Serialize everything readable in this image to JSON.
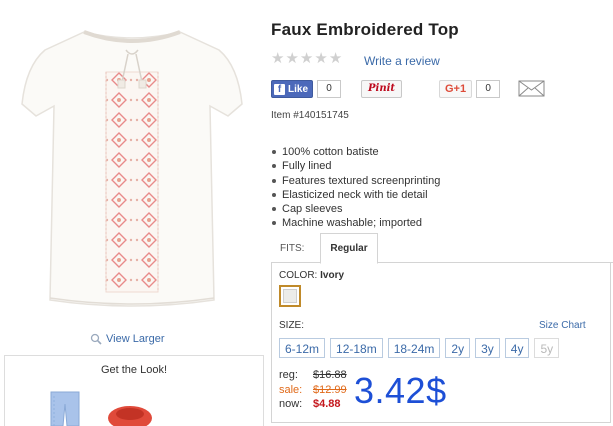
{
  "product": {
    "title": "Faux Embroidered Top",
    "item_number": "Item #140151745",
    "rating_stars": 5,
    "write_review": "Write a review",
    "view_larger": "View Larger",
    "features": [
      "100% cotton batiste",
      "Fully lined",
      "Features textured screenprinting",
      "Elasticized neck with tie detail",
      "Cap sleeves",
      "Machine washable; imported"
    ]
  },
  "social": {
    "facebook_label": "Like",
    "facebook_count": "0",
    "pinterest_label": "Pinit",
    "gplus_label": "G+1",
    "gplus_count": "0"
  },
  "fits": {
    "label": "FITS:",
    "tabs": [
      "Regular"
    ]
  },
  "color": {
    "label": "COLOR:",
    "selected": "Ivory",
    "swatch_hex": "#ececea"
  },
  "size": {
    "label": "SIZE:",
    "chart_link": "Size Chart",
    "options": [
      "6-12m",
      "12-18m",
      "18-24m",
      "2y",
      "3y",
      "4y",
      "5y"
    ]
  },
  "price": {
    "reg_label": "reg:",
    "reg_value": "$16.88",
    "sale_label": "sale:",
    "sale_value": "$12.99",
    "now_label": "now:",
    "now_value": "$4.88",
    "overlay_price": "3.42$"
  },
  "get_the_look": {
    "title": "Get the Look!"
  },
  "colors": {
    "link": "#3b6aa8",
    "sale": "#e06a1a",
    "now": "#c4161c",
    "overlay": "#1d4fd6",
    "swatch_border": "#c08a2a"
  }
}
